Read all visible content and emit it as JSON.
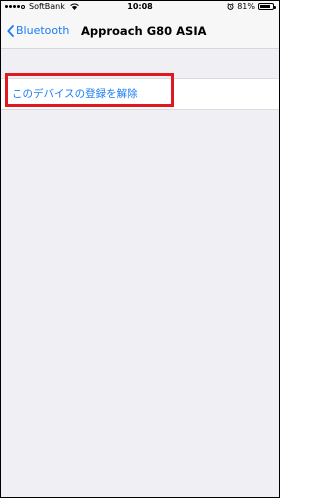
{
  "status_bar": {
    "carrier": "SoftBank",
    "time": "10:08",
    "battery_percent": "81%",
    "battery_level": 0.81,
    "signal_bars_filled": 4,
    "signal_bars_total": 5,
    "icons": [
      "signal-icon",
      "wifi-icon",
      "alarm-icon",
      "battery-icon"
    ]
  },
  "nav": {
    "back_label": "Bluetooth",
    "title": "Approach G80 ASIA"
  },
  "cells": [
    {
      "label": "このデバイスの登録を解除"
    }
  ],
  "colors": {
    "accent": "#1a7cf5",
    "highlight": "#e0181f",
    "background": "#efeff4"
  }
}
